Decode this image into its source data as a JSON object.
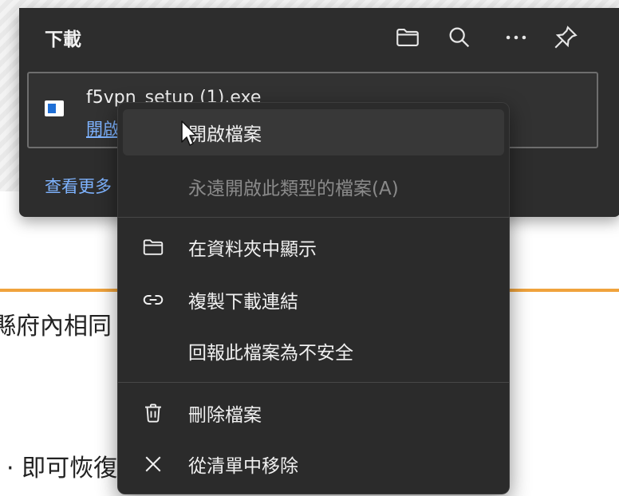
{
  "background": {
    "text_line1": "縣府內相同",
    "text_line2": "· 即可恢復"
  },
  "downloads": {
    "title": "下載",
    "item": {
      "filename": "f5vpn_setup (1).exe",
      "action_link": "開啟檔案"
    },
    "see_more": "查看更多"
  },
  "context_menu": {
    "items": [
      {
        "label": "開啟檔案",
        "icon": "none"
      },
      {
        "label": "永遠開啟此類型的檔案(A)",
        "icon": "none",
        "disabled": true
      },
      {
        "label": "在資料夾中顯示",
        "icon": "folder-icon"
      },
      {
        "label": "複製下載連結",
        "icon": "link-icon"
      },
      {
        "label": "回報此檔案為不安全",
        "icon": "none"
      },
      {
        "label": "刪除檔案",
        "icon": "trash-icon"
      },
      {
        "label": "從清單中移除",
        "icon": "close-icon"
      }
    ]
  },
  "colors": {
    "flyout_bg": "#2d2d2d",
    "menu_bg": "#2b2b2b",
    "link": "#7eb3ff",
    "accent_rule": "#f0a33c"
  }
}
